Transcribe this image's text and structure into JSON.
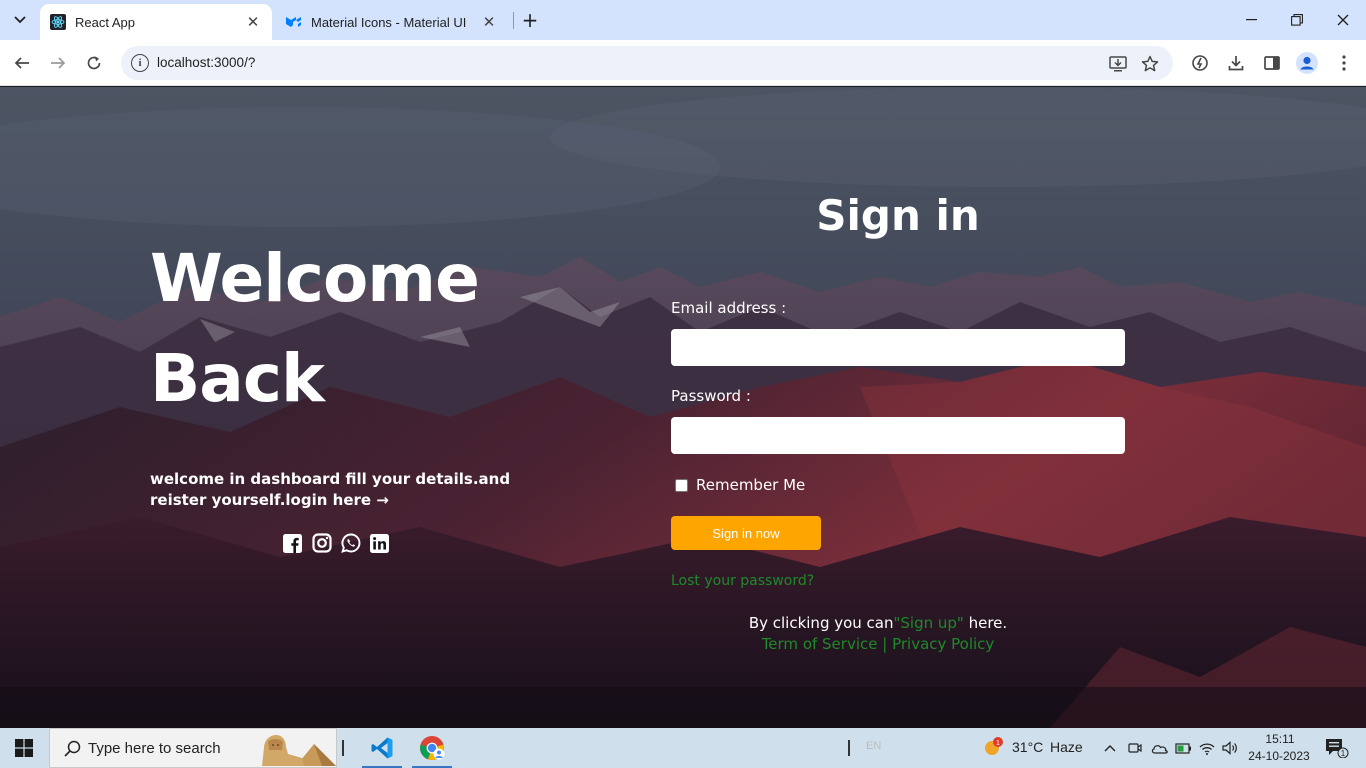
{
  "browser": {
    "tabs": [
      {
        "title": "React App",
        "active": true
      },
      {
        "title": "Material Icons - Material UI",
        "active": false
      }
    ],
    "new_tab_label": "+",
    "url": "localhost:3000/?"
  },
  "page": {
    "welcome_line1": "Welcome",
    "welcome_line2": "Back",
    "subtext": "welcome in dashboard fill your details.and reister yourself.login here →",
    "social_icons": [
      "facebook-icon",
      "instagram-icon",
      "whatsapp-icon",
      "linkedin-icon"
    ],
    "signin_title": "Sign in",
    "email_label": "Email address :",
    "email_value": "",
    "password_label": "Password :",
    "password_value": "",
    "remember_label": "Remember Me",
    "signin_button": "Sign in now",
    "lost_password": "Lost your password?",
    "bottom_prefix": "By clicking you can",
    "signup_link": "\"Sign up\"",
    "bottom_suffix": " here.",
    "terms": "Term of Service",
    "terms_sep": " | ",
    "privacy": "Privacy Policy",
    "colors": {
      "accent": "#ffa500",
      "link": "#1d8a2a",
      "text": "#ffffff"
    }
  },
  "taskbar": {
    "search_placeholder": "Type here to search",
    "ime": "EN",
    "weather_temp": "31°C",
    "weather_text": "Haze",
    "weather_badge": "1",
    "time": "15:11",
    "date": "24-10-2023",
    "notification_count": "1"
  }
}
